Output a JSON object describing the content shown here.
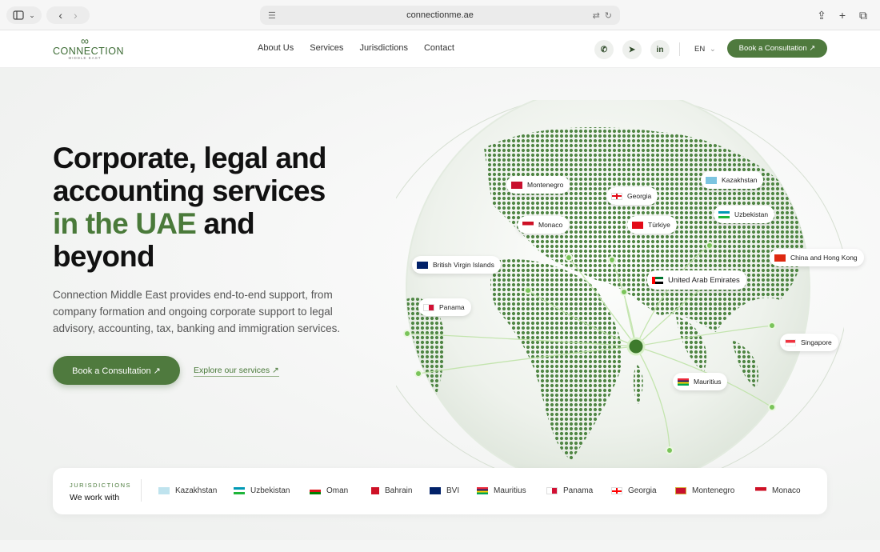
{
  "browser": {
    "url": "connectionme.ae"
  },
  "brand": {
    "name": "CONNECTION",
    "sub": "MIDDLE EAST",
    "accent_color": "#4f7a3e"
  },
  "nav": {
    "items": [
      "About Us",
      "Services",
      "Jurisdictions",
      "Contact"
    ],
    "language": "EN",
    "cta": "Book a Consultation ↗"
  },
  "hero": {
    "headline_1": "Corporate, legal and accounting services ",
    "headline_accent": "in the UAE",
    "headline_2": " and beyond",
    "lede": "Connection Middle East provides end-to-end support, from company formation and ongoing corporate support to legal advisory, accounting, tax, banking and immigration services.",
    "cta_primary": "Book a Consultation ↗",
    "cta_secondary": "Explore our services ↗"
  },
  "globe_labels": [
    {
      "name": "Montenegro",
      "flag": "#c8102e"
    },
    {
      "name": "Georgia",
      "flag": "#ffffff"
    },
    {
      "name": "Kazakhstan",
      "flag": "#7cc4e0"
    },
    {
      "name": "Monaco",
      "flag": "#ce1126"
    },
    {
      "name": "Türkiye",
      "flag": "#e30a17"
    },
    {
      "name": "Uzbekistan",
      "flag": "#1eb53a"
    },
    {
      "name": "British Virgin Islands",
      "flag": "#012169"
    },
    {
      "name": "China and Hong Kong",
      "flag": "#de2910"
    },
    {
      "name": "United Arab Emirates",
      "flag": "#00732f"
    },
    {
      "name": "Panama",
      "flag": "#005293"
    },
    {
      "name": "Singapore",
      "flag": "#ef3340"
    },
    {
      "name": "Mauritius",
      "flag": "#ea2839"
    }
  ],
  "jurisdictions": {
    "kicker": "JURISDICTIONS",
    "title": "We work with",
    "items": [
      {
        "name": "Kazakhstan",
        "flag": "#bfe3ee"
      },
      {
        "name": "Uzbekistan",
        "flag": "#1eb53a"
      },
      {
        "name": "Oman",
        "flag": "#db161b"
      },
      {
        "name": "Bahrain",
        "flag": "#ce1126"
      },
      {
        "name": "BVI",
        "flag": "#012169"
      },
      {
        "name": "Mauritius",
        "flag": "#ea2839"
      },
      {
        "name": "Panama",
        "flag": "#005293"
      },
      {
        "name": "Georgia",
        "flag": "#ff0000"
      },
      {
        "name": "Montenegro",
        "flag": "#c8102e"
      },
      {
        "name": "Monaco",
        "flag": "#ce1126"
      }
    ]
  }
}
